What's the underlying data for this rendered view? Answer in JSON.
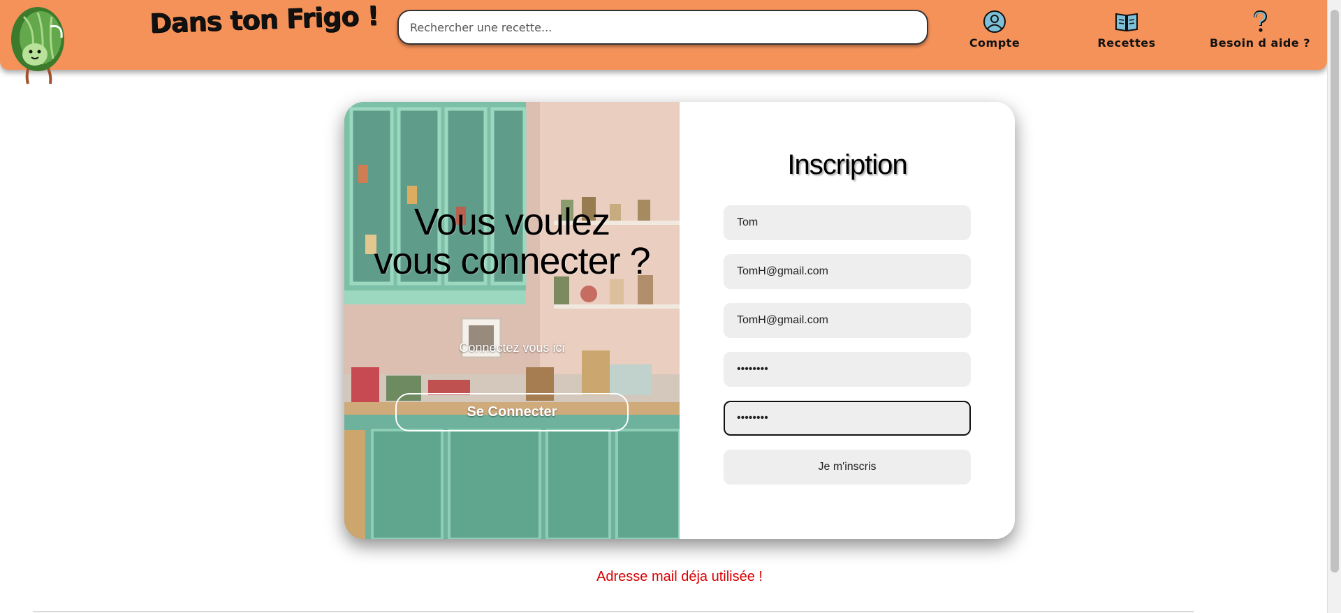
{
  "header": {
    "site_title": "Dans ton Frigo !",
    "search_placeholder": "Rechercher une recette...",
    "nav": [
      {
        "label": "Compte",
        "icon": "user-circle-icon"
      },
      {
        "label": "Recettes",
        "icon": "book-icon"
      },
      {
        "label": "Besoin d aide ?",
        "icon": "question-mark-icon"
      }
    ]
  },
  "login_panel": {
    "title": "Vous voulez vous connecter ?",
    "subtitle": "Connectez vous ici",
    "button_label": "Se Connecter"
  },
  "signup_form": {
    "title": "Inscription",
    "fields": [
      {
        "value": "Tom"
      },
      {
        "value": "TomH@gmail.com"
      },
      {
        "value": "TomH@gmail.com"
      },
      {
        "value": "12345678"
      },
      {
        "value": "12345678"
      }
    ],
    "submit_label": "Je m'inscris"
  },
  "error_message": "Adresse mail déja utilisée !",
  "colors": {
    "header_bg": "#f5925a",
    "error": "#d80000",
    "field_bg": "#eeeeee"
  }
}
